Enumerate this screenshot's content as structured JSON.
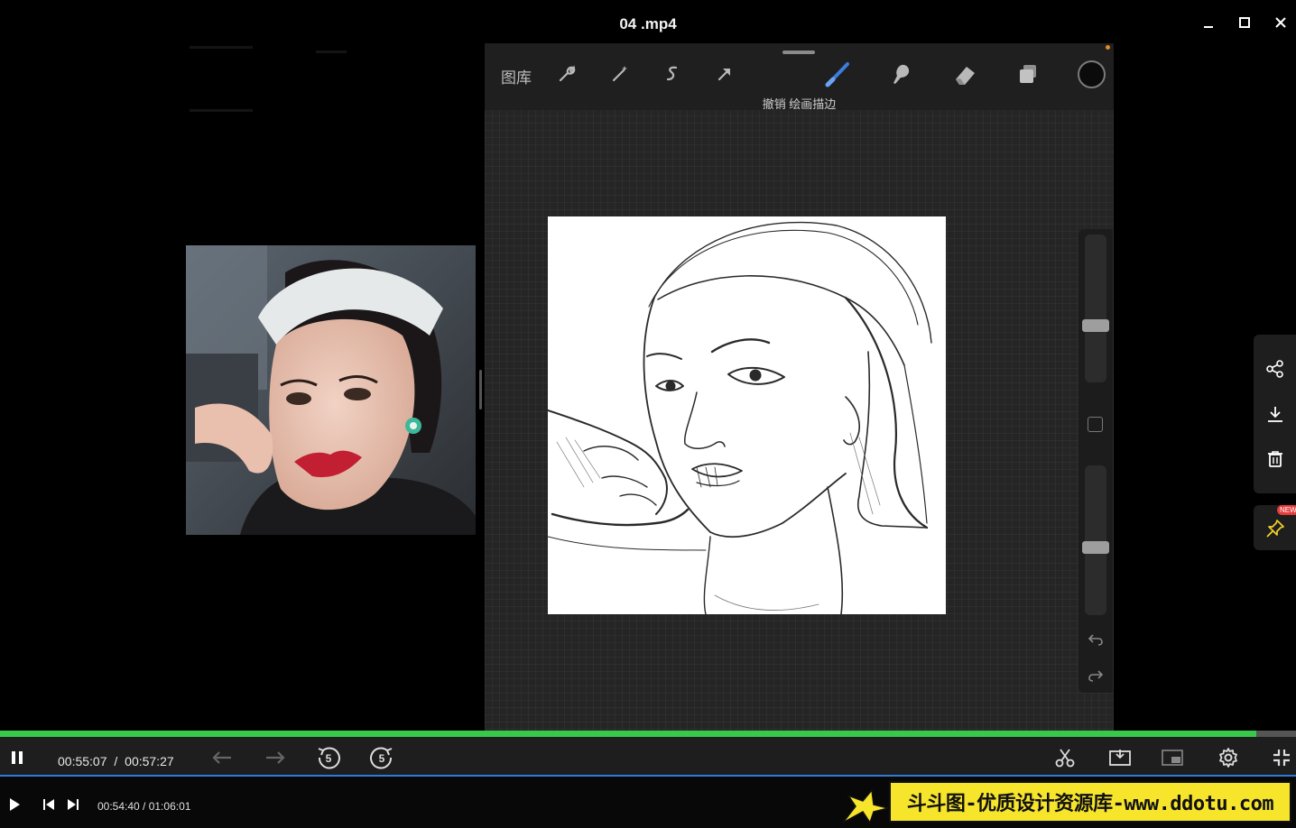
{
  "window": {
    "title": "04 .mp4"
  },
  "procreate": {
    "gallery_label": "图库",
    "undo_message": "撤销 绘画描边"
  },
  "sidebar_panel": {
    "new_badge": "NEW"
  },
  "player": {
    "current_time": "00:55:07",
    "separator": "/",
    "total_time": "00:57:27",
    "progress": 0.9694,
    "seek_back_seconds": "5",
    "seek_forward_seconds": "5"
  },
  "secondary_player": {
    "time_display": "00:54:40 / 01:06:01"
  },
  "watermark": {
    "text": "斗斗图-优质设计资源库-www.ddotu.com",
    "background": "#f7e52b"
  },
  "colors": {
    "progress_fill": "#38c94a",
    "brush_active": "#3b7ddd",
    "timeline_line": "#2f7bd6"
  }
}
